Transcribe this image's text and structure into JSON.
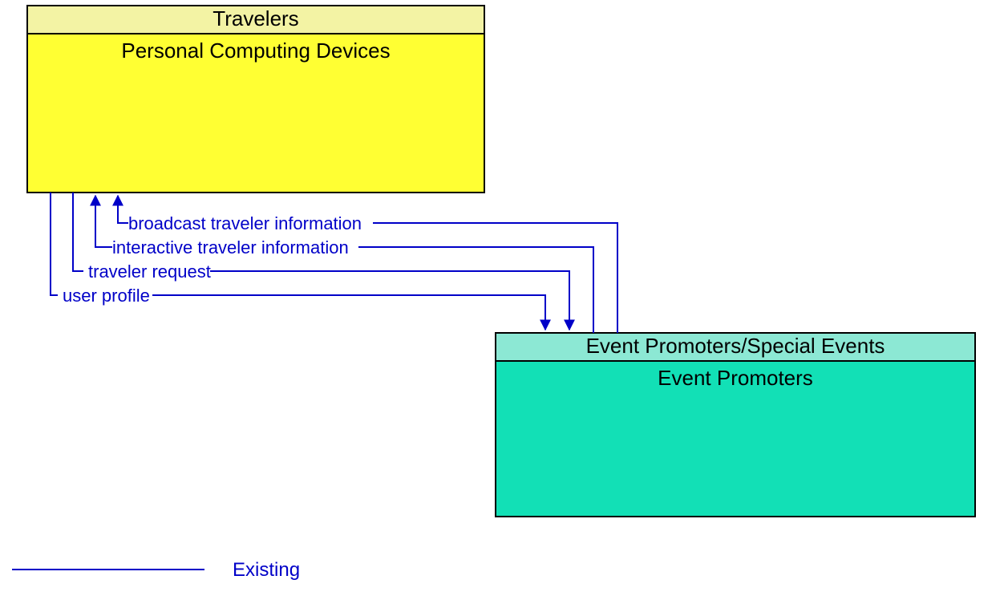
{
  "nodes": {
    "top": {
      "header": "Travelers",
      "body": "Personal Computing Devices",
      "headerFill": "#f3f3a4",
      "bodyFill": "#ffff33"
    },
    "bottom": {
      "header": "Event Promoters/Special Events",
      "body": "Event Promoters",
      "headerFill": "#8ce8d4",
      "bodyFill": "#12e0b6"
    }
  },
  "flows": {
    "broadcast": "broadcast traveler information",
    "interactive": "interactive traveler information",
    "traveler_request": "traveler request",
    "user_profile": "user profile"
  },
  "legend": {
    "existing": "Existing"
  }
}
